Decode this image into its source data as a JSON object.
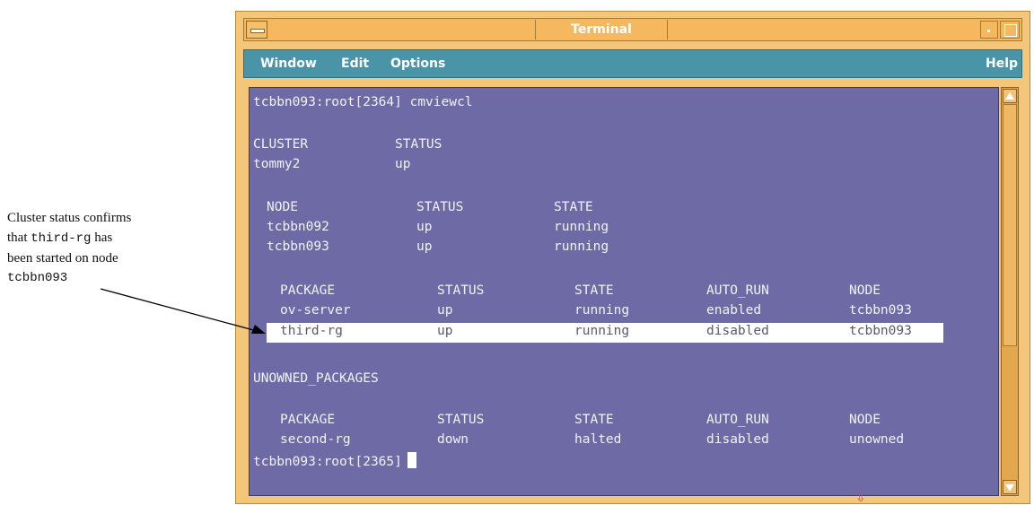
{
  "callout": {
    "line1": "Cluster status confirms",
    "line2_pre": "that ",
    "line2_code": "third-rg",
    "line2_post": " has",
    "line3": "been started on node",
    "line4_code": "tcbbn093"
  },
  "window": {
    "title": "Terminal",
    "menu": {
      "window": "Window",
      "edit": "Edit",
      "options": "Options",
      "help": "Help"
    }
  },
  "terminal": {
    "prompt1": "tcbbn093:root[2364] cmviewcl",
    "cluster_headers": [
      "CLUSTER",
      "STATUS"
    ],
    "cluster_row": [
      "tommy2",
      "up"
    ],
    "node_headers": [
      "NODE",
      "STATUS",
      "STATE"
    ],
    "nodes": [
      [
        "tcbbn092",
        "up",
        "running"
      ],
      [
        "tcbbn093",
        "up",
        "running"
      ]
    ],
    "package_headers": [
      "PACKAGE",
      "STATUS",
      "STATE",
      "AUTO_RUN",
      "NODE"
    ],
    "packages": [
      [
        "ov-server",
        "up",
        "running",
        "enabled",
        "tcbbn093"
      ],
      [
        "third-rg",
        "up",
        "running",
        "disabled",
        "tcbbn093"
      ]
    ],
    "unowned_title": "UNOWNED_PACKAGES",
    "unowned_headers": [
      "PACKAGE",
      "STATUS",
      "STATE",
      "AUTO_RUN",
      "NODE"
    ],
    "unowned": [
      [
        "second-rg",
        "down",
        "halted",
        "disabled",
        "unowned"
      ]
    ],
    "prompt2": "tcbbn093:root[2365]"
  },
  "colors": {
    "frame": "#f4c67a",
    "menubar": "#4a94a8",
    "terminal_bg": "#6d6aa6",
    "terminal_fg": "#f2f2f7"
  }
}
